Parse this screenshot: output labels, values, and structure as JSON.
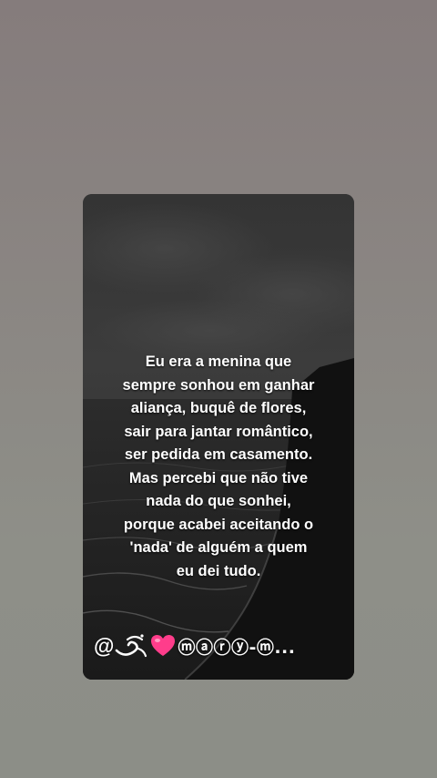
{
  "quote": {
    "lines": [
      "Eu era a menina que",
      "sempre sonhou em ganhar",
      "aliança, buquê de flores,",
      "sair para jantar romântico,",
      "ser pedida em casamento.",
      "Mas percebi que não tive",
      "nada do que sonhei,",
      "porque acabei aceitando o",
      "'nada' de alguém a quem",
      "eu dei tudo."
    ]
  },
  "signature": {
    "prefix": "@",
    "name": "ⓜⓐⓡⓨ-ⓜ...",
    "icons": [
      "swirl-icon",
      "heart-icon"
    ]
  },
  "colors": {
    "background_top": "#857c7c",
    "background_bottom": "#8c8e87",
    "card_dark": "#151515",
    "text": "#ffffff",
    "heart": "#ff3d8b"
  }
}
